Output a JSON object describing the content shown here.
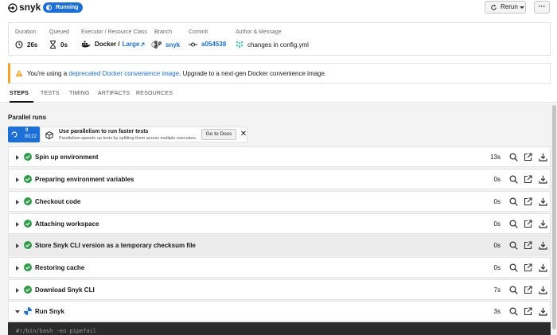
{
  "header": {
    "title": "snyk",
    "status": "Running",
    "rerun_label": "Rerun",
    "more_label": "···"
  },
  "info": {
    "duration_label": "Duration",
    "duration_value": "26s",
    "queued_label": "Queued",
    "queued_value": "0s",
    "executor_label": "Executor / Resource Class",
    "executor_value": "Docker /",
    "resource_value": "Large",
    "branch_label": "Branch",
    "branch_value": "snyk",
    "commit_label": "Commit",
    "commit_value": "a054538",
    "author_label": "Author & Message",
    "author_message": "changes in config.yml"
  },
  "warning": {
    "prefix": "You're using a",
    "link": "deprecated Docker convenience image",
    "suffix": ". Upgrade to a next-gen Docker convenience image."
  },
  "tabs": [
    "STEPS",
    "TESTS",
    "TIMING",
    "ARTIFACTS",
    "RESOURCES"
  ],
  "parallel": {
    "title": "Parallel runs",
    "run_index": "0",
    "run_time": "00:22",
    "tip_title": "Use parallelism to run faster tests",
    "tip_sub": "Parallelism speeds up tests by splitting them across multiple executors.",
    "docs_label": "Go to Docs"
  },
  "steps": [
    {
      "name": "Spin up environment",
      "duration": "13s",
      "status": "success"
    },
    {
      "name": "Preparing environment variables",
      "duration": "0s",
      "status": "success"
    },
    {
      "name": "Checkout code",
      "duration": "0s",
      "status": "success"
    },
    {
      "name": "Attaching workspace",
      "duration": "0s",
      "status": "success"
    },
    {
      "name": "Store Snyk CLI version as a temporary checksum file",
      "duration": "0s",
      "status": "success"
    },
    {
      "name": "Restoring cache",
      "duration": "0s",
      "status": "success"
    },
    {
      "name": "Download Snyk CLI",
      "duration": "7s",
      "status": "success"
    },
    {
      "name": "Run Snyk",
      "duration": "3s",
      "status": "running"
    }
  ],
  "terminal": {
    "line": "#!/bin/bash -eo pipefail"
  },
  "colors": {
    "accent": "#1b6fd6",
    "success": "#2a9d45",
    "warning": "#f3a32c"
  }
}
